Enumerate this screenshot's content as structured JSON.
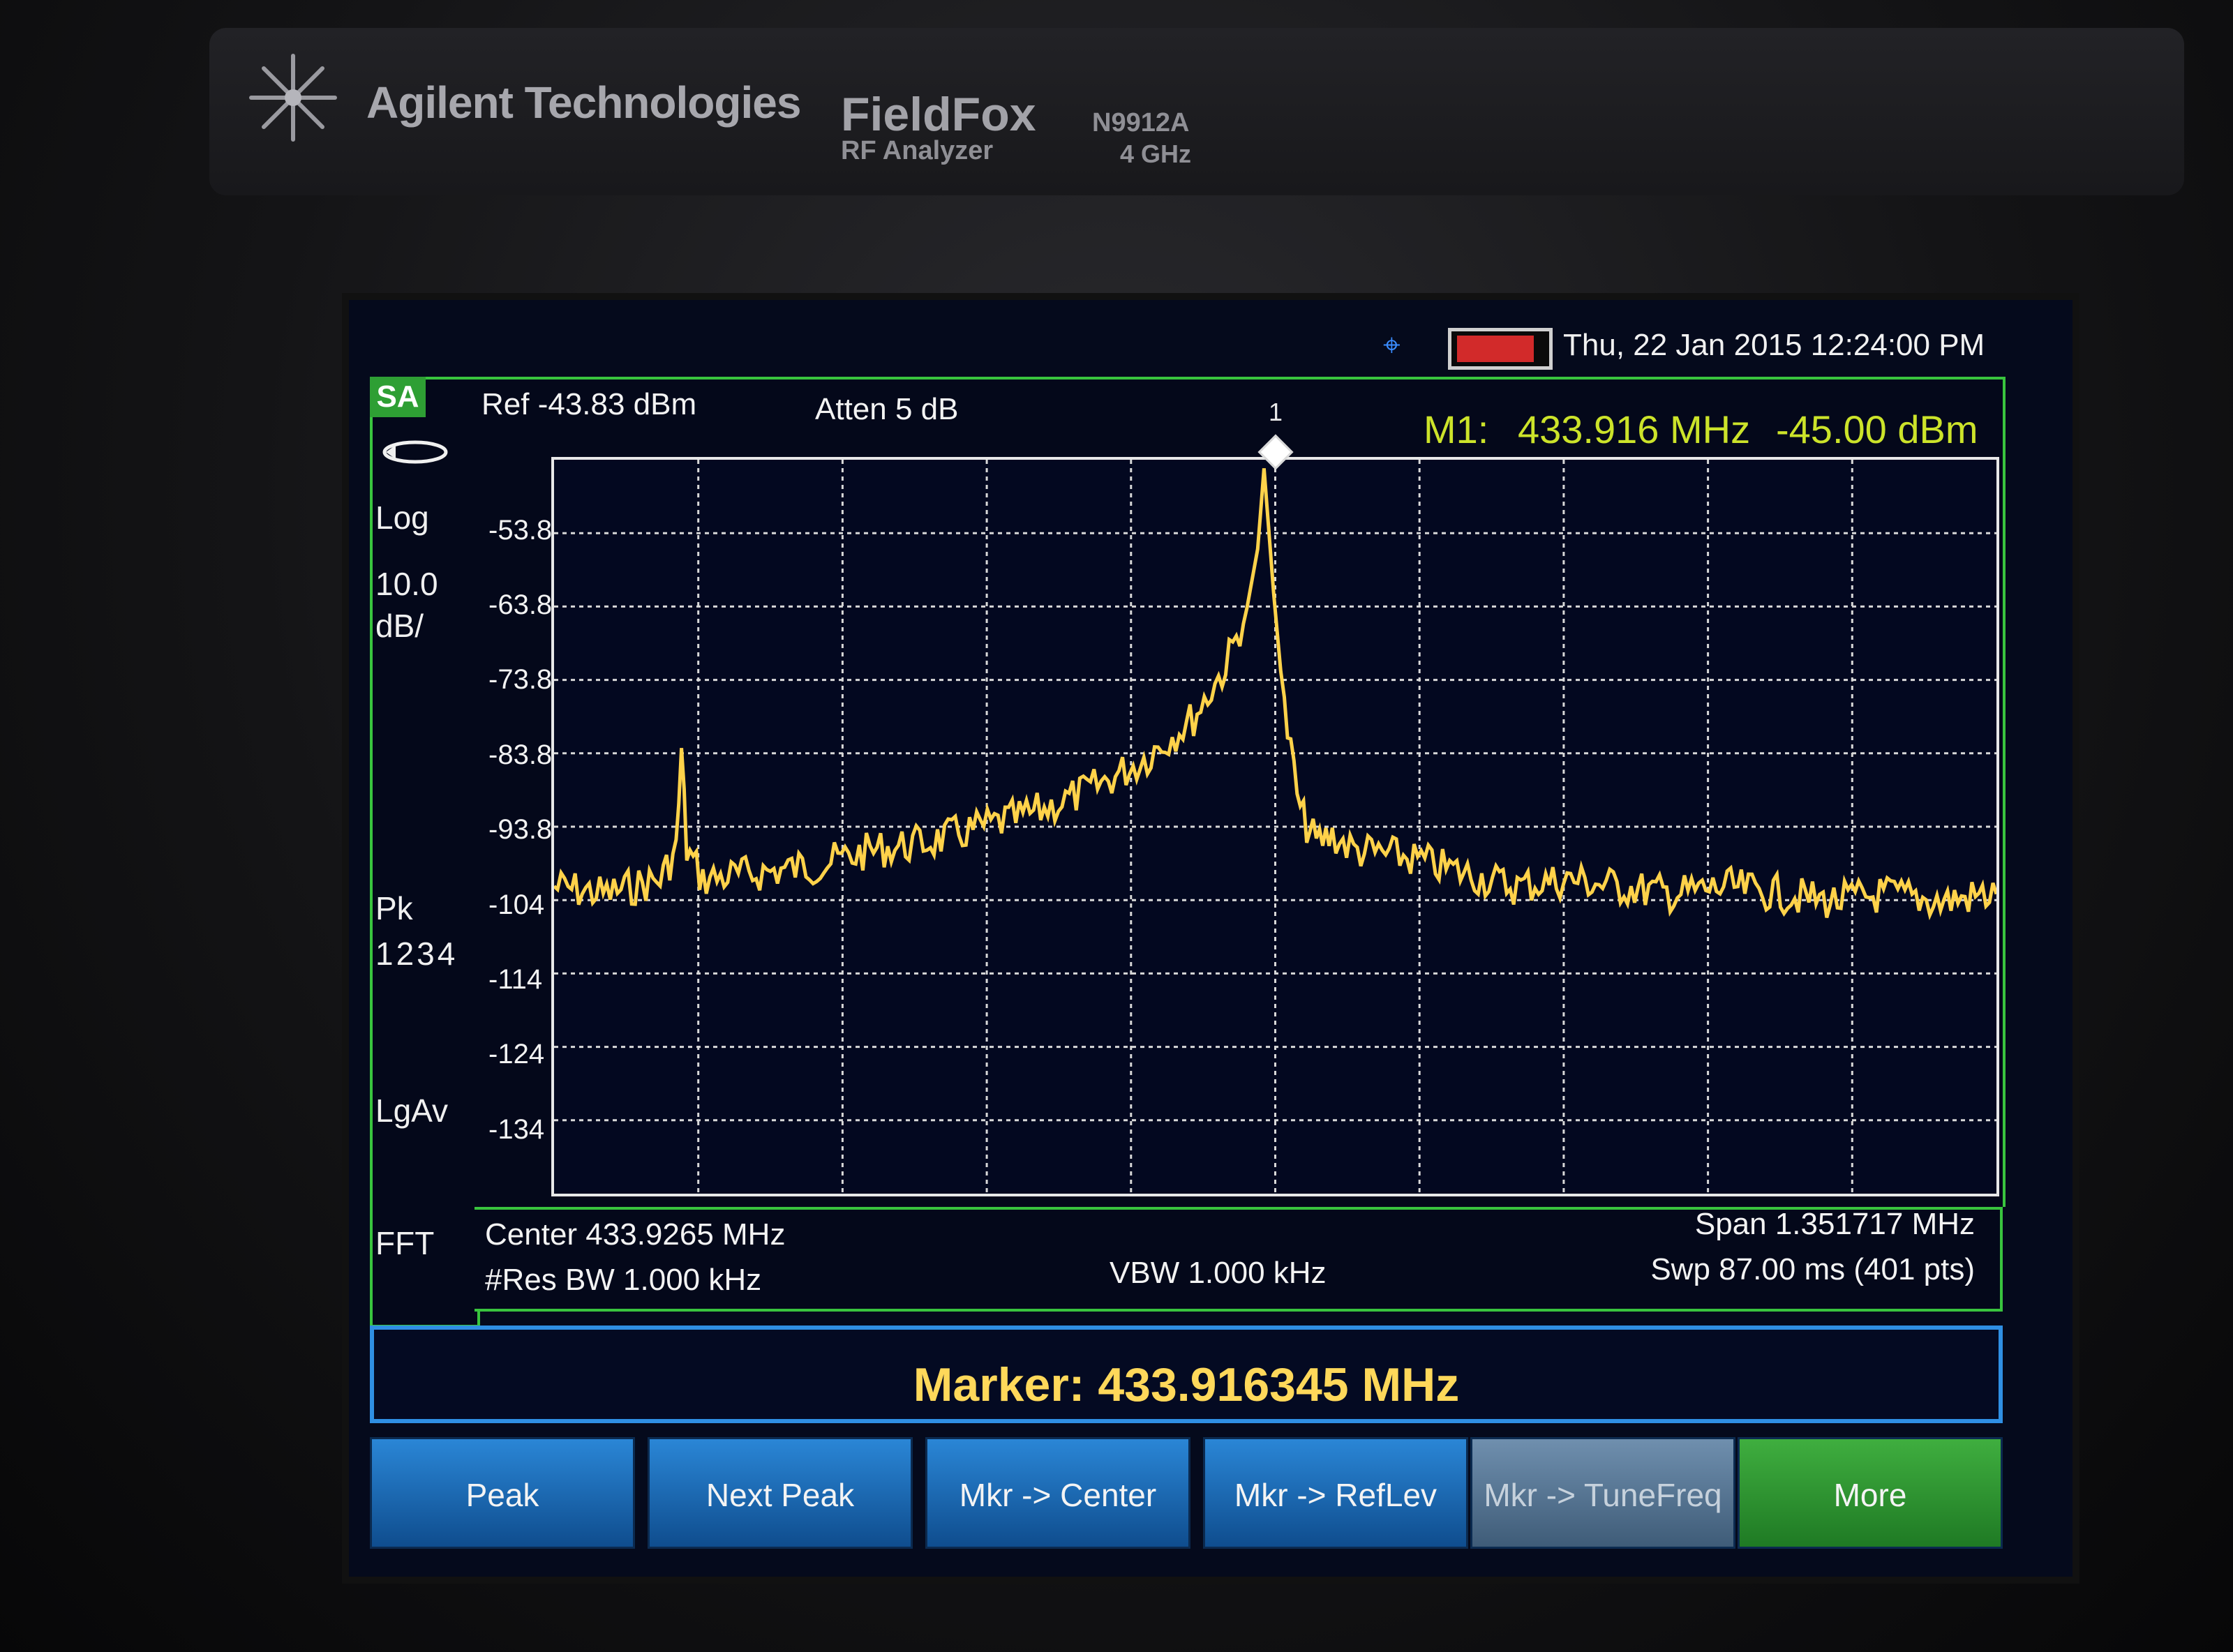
{
  "device": {
    "brand": "Agilent Technologies",
    "product": "FieldFox",
    "product_sub": "RF Analyzer",
    "model": "N9912A",
    "model_sub": "4 GHz"
  },
  "status": {
    "datetime": "Thu, 22 Jan 2015 12:24:00 PM",
    "gps_icon": "gps-icon",
    "battery_icon": "battery-icon",
    "battery_color": "#d22a2a"
  },
  "left_panel": {
    "mode": "SA",
    "scale_type": "Log",
    "scale_value": "10.0",
    "scale_unit": "dB/",
    "detector": "Pk",
    "traces": "1234",
    "averaging": "LgAv",
    "sweep_type": "FFT"
  },
  "top_info": {
    "ref_level": "Ref -43.83 dBm",
    "attenuation": "Atten 5 dB",
    "marker_label": "M1:",
    "marker_freq": "433.916 MHz",
    "marker_amp": "-45.00 dBm",
    "marker_number": "1"
  },
  "bottom_info": {
    "center": "Center 433.9265 MHz",
    "res_bw": "#Res BW 1.000 kHz",
    "vbw": "VBW 1.000 kHz",
    "span": "Span 1.351717 MHz",
    "sweep": "Swp 87.00 ms (401 pts)"
  },
  "marker_entry": "Marker: 433.916345 MHz",
  "softkeys": [
    {
      "label": "Peak"
    },
    {
      "label": "Next Peak"
    },
    {
      "label": "Mkr -> Center"
    },
    {
      "label": "Mkr -> RefLev"
    },
    {
      "label": "Mkr -> TuneFreq"
    },
    {
      "label": "More"
    }
  ],
  "colors": {
    "trace": "#ffd24a",
    "frame": "#39c43e",
    "grid": "#d8d8d8",
    "marker_readout": "#cce32a",
    "softkey": "#2a86d6",
    "softkey_more": "#3fae3f"
  },
  "chart_data": {
    "type": "line",
    "y_tick_labels": [
      "-53.8",
      "-63.8",
      "-73.8",
      "-83.8",
      "-93.8",
      "-104",
      "-114",
      "-124",
      "-134"
    ],
    "ylim": [
      -143.83,
      -43.83
    ],
    "xlim": [
      433.2506,
      434.6024
    ],
    "grid": true,
    "series": [
      {
        "x": [
          433.2506,
          433.3,
          433.35,
          433.365,
          433.37,
          433.375,
          433.39,
          433.45,
          433.5,
          433.55,
          433.6,
          433.65,
          433.7,
          433.75,
          433.8,
          433.85,
          433.88,
          433.9,
          433.91,
          433.916,
          433.925,
          433.935,
          433.95,
          433.965,
          433.98,
          434.0,
          434.05,
          434.1,
          434.15,
          434.2,
          434.25,
          434.3,
          434.35,
          434.4,
          434.45,
          434.5,
          434.55,
          434.6024
        ],
        "y": [
          -102,
          -103,
          -101,
          -97,
          -84,
          -97,
          -101,
          -100,
          -99,
          -97,
          -96,
          -94,
          -92,
          -89,
          -85,
          -79,
          -72,
          -64,
          -56,
          -45,
          -62,
          -78,
          -92,
          -96,
          -95,
          -97,
          -98,
          -100,
          -102,
          -101,
          -102,
          -103,
          -102,
          -103,
          -104,
          -103,
          -104,
          -103
        ]
      }
    ]
  }
}
